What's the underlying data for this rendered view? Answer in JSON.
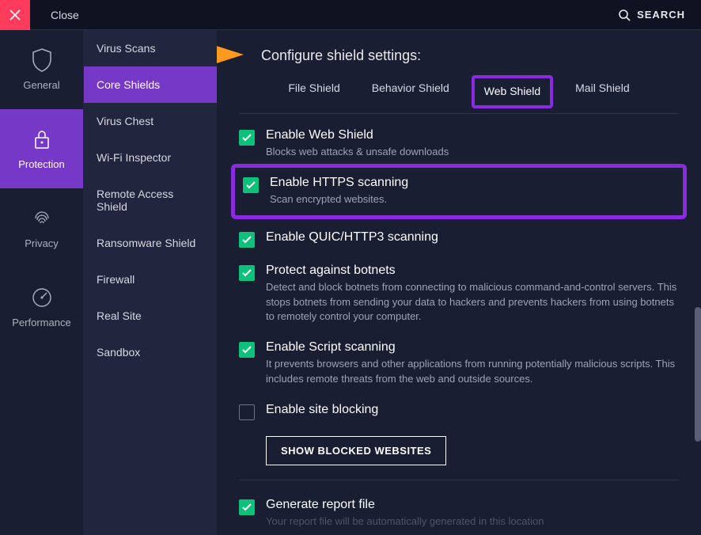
{
  "titlebar": {
    "close": "Close",
    "search": "SEARCH"
  },
  "nav": [
    {
      "id": "general",
      "label": "General"
    },
    {
      "id": "protection",
      "label": "Protection"
    },
    {
      "id": "privacy",
      "label": "Privacy"
    },
    {
      "id": "performance",
      "label": "Performance"
    }
  ],
  "subnav": {
    "items": [
      "Virus Scans",
      "Core Shields",
      "Virus Chest",
      "Wi-Fi Inspector",
      "Remote Access Shield",
      "Ransomware Shield",
      "Firewall",
      "Real Site",
      "Sandbox"
    ]
  },
  "content": {
    "heading": "Configure shield settings:",
    "tabs": [
      "File Shield",
      "Behavior Shield",
      "Web Shield",
      "Mail Shield"
    ],
    "settings": [
      {
        "key": "web",
        "title": "Enable Web Shield",
        "desc": "Blocks web attacks & unsafe downloads",
        "checked": true
      },
      {
        "key": "https",
        "title": "Enable HTTPS scanning",
        "desc": "Scan encrypted websites.",
        "checked": true
      },
      {
        "key": "quic",
        "title": "Enable QUIC/HTTP3 scanning",
        "desc": "",
        "checked": true
      },
      {
        "key": "botnet",
        "title": "Protect against botnets",
        "desc": "Detect and block botnets from connecting to malicious command-and-control servers. This stops botnets from sending your data to hackers and prevents hackers from using botnets to remotely control your computer.",
        "checked": true
      },
      {
        "key": "script",
        "title": "Enable Script scanning",
        "desc": "It prevents browsers and other applications from running potentially malicious scripts. This includes remote threats from the web and outside sources.",
        "checked": true
      },
      {
        "key": "siteblock",
        "title": "Enable site blocking",
        "desc": "",
        "checked": false
      },
      {
        "key": "report",
        "title": "Generate report file",
        "desc": "Your report file will be automatically generated in this location",
        "checked": true
      }
    ],
    "blocked_btn": "SHOW BLOCKED WEBSITES"
  }
}
